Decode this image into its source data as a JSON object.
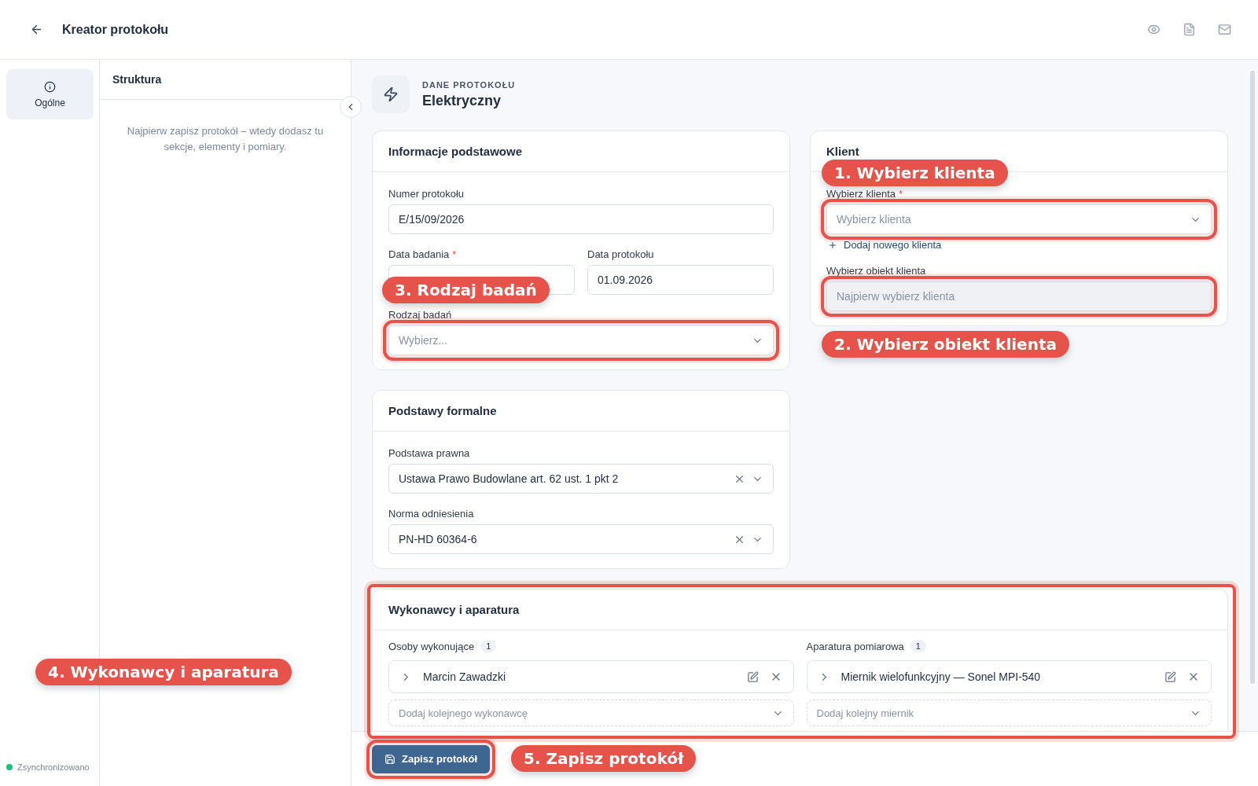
{
  "header": {
    "title": "Kreator protokołu"
  },
  "rail": {
    "items": [
      {
        "label": "Ogólne",
        "selected": true
      }
    ]
  },
  "sidebar": {
    "title": "Struktura",
    "empty_message": "Najpierw zapisz protokół – wtedy dodasz tu sekcje, elementy i pomiary."
  },
  "sync_status": {
    "label": "Zsynchronizowano"
  },
  "protocol": {
    "eyebrow": "DANE PROTOKOŁU",
    "type": "Elektryczny"
  },
  "info_card": {
    "title": "Informacje podstawowe",
    "rows": [
      [
        {
          "label": "Numer protokołu",
          "kind": "text",
          "value": "E/15/09/2026",
          "disabled": false,
          "highlighted": false
        }
      ],
      [
        {
          "label": "Data badania",
          "required_mark": "*",
          "kind": "text",
          "disabled": false,
          "highlighted": false
        },
        {
          "label": "Data protokołu",
          "kind": "text",
          "value": "01.09.2026",
          "disabled": false,
          "highlighted": false
        }
      ],
      [
        {
          "label": "Rodzaj badań",
          "kind": "select",
          "placeholder": "Wybierz...",
          "disabled": false,
          "highlighted": true
        }
      ]
    ]
  },
  "client_card": {
    "title": "Klient",
    "client_field": {
      "label": "Wybierz klienta",
      "required_mark": "*",
      "kind": "select",
      "placeholder": "Wybierz klienta",
      "disabled": false,
      "highlighted": true
    },
    "add_link": "Dodaj nowego klienta",
    "object_field": {
      "label": "Wybierz obiekt klienta",
      "kind": "text",
      "placeholder": "Najpierw wybierz klienta",
      "disabled": true,
      "highlighted": true
    }
  },
  "formal_card": {
    "title": "Podstawy formalne",
    "rows": [
      [
        {
          "label": "Podstawa prawna",
          "kind": "clearable-select",
          "value": "Ustawa Prawo Budowlane art. 62 ust. 1 pkt 2",
          "disabled": false,
          "highlighted": false
        }
      ],
      [
        {
          "label": "Norma odniesienia",
          "kind": "clearable-select",
          "value": "PN-HD 60364-6",
          "disabled": false,
          "highlighted": false
        }
      ]
    ]
  },
  "team_card": {
    "title": "Wykonawcy i aparatura",
    "highlighted": true,
    "sections": [
      {
        "title": "Osoby wykonujące",
        "count": "1",
        "items": [
          "Marcin Zawadzki"
        ],
        "add_placeholder": "Dodaj kolejnego wykonawcę"
      },
      {
        "title": "Aparatura pomiarowa",
        "count": "1",
        "items": [
          "Miernik wielofunkcyjny — Sonel MPI-540"
        ],
        "add_placeholder": "Dodaj kolejny miernik"
      }
    ]
  },
  "footer": {
    "save_button": {
      "label": "Zapisz protokół",
      "highlighted": true
    }
  },
  "annotations": [
    {
      "label": "1. Wybierz klienta"
    },
    {
      "label": "2. Wybierz obiekt klienta"
    },
    {
      "label": "3. Rodzaj badań"
    },
    {
      "label": "4. Wykonawcy i aparatura"
    },
    {
      "label": "5. Zapisz protokół"
    }
  ]
}
